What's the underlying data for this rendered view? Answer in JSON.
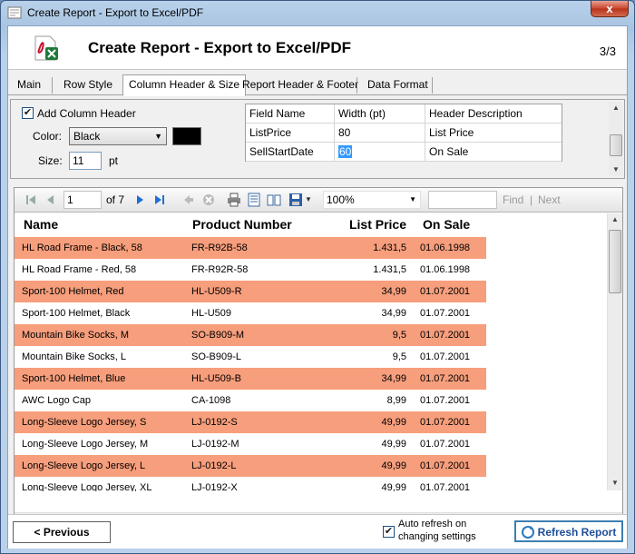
{
  "window": {
    "title": "Create Report - Export to Excel/PDF",
    "close_glyph": "x"
  },
  "header": {
    "title": "Create Report - Export to Excel/PDF",
    "step": "3/3",
    "icon": "excel-pdf-icon"
  },
  "tabs": [
    {
      "label": "Main"
    },
    {
      "label": "Row Style"
    },
    {
      "label": "Column Header & Size",
      "active": true
    },
    {
      "label": "Report Header & Footer"
    },
    {
      "label": "Data Format"
    }
  ],
  "column_header": {
    "add_label": "Add Column Header",
    "add_checked": true,
    "color_label": "Color:",
    "color_value": "Black",
    "color_swatch": "#000000",
    "size_label": "Size:",
    "size_value": "11",
    "size_unit": "pt"
  },
  "fields_grid": {
    "headers": [
      "Field Name",
      "Width (pt)",
      "Header Description"
    ],
    "rows": [
      [
        "ListPrice",
        "80",
        "List Price"
      ],
      [
        "SellStartDate",
        "60",
        "On Sale"
      ]
    ]
  },
  "toolbar": {
    "page_value": "1",
    "page_of": "of 7",
    "zoom": "100%",
    "find": "Find",
    "next": "Next"
  },
  "report": {
    "headers": [
      "Name",
      "Product Number",
      "List Price",
      "On Sale"
    ],
    "row_color": "#f79e7c",
    "rows": [
      [
        "HL Road Frame - Black, 58",
        "FR-R92B-58",
        "1.431,5",
        "01.06.1998"
      ],
      [
        "HL Road Frame - Red, 58",
        "FR-R92R-58",
        "1.431,5",
        "01.06.1998"
      ],
      [
        "Sport-100 Helmet, Red",
        "HL-U509-R",
        "34,99",
        "01.07.2001"
      ],
      [
        "Sport-100 Helmet, Black",
        "HL-U509",
        "34,99",
        "01.07.2001"
      ],
      [
        "Mountain Bike Socks, M",
        "SO-B909-M",
        "9,5",
        "01.07.2001"
      ],
      [
        "Mountain Bike Socks, L",
        "SO-B909-L",
        "9,5",
        "01.07.2001"
      ],
      [
        "Sport-100 Helmet, Blue",
        "HL-U509-B",
        "34,99",
        "01.07.2001"
      ],
      [
        "AWC Logo Cap",
        "CA-1098",
        "8,99",
        "01.07.2001"
      ],
      [
        "Long-Sleeve Logo Jersey, S",
        "LJ-0192-S",
        "49,99",
        "01.07.2001"
      ],
      [
        "Long-Sleeve Logo Jersey, M",
        "LJ-0192-M",
        "49,99",
        "01.07.2001"
      ],
      [
        "Long-Sleeve Logo Jersey, L",
        "LJ-0192-L",
        "49,99",
        "01.07.2001"
      ],
      [
        "Long-Sleeve Logo Jersey, XL",
        "LJ-0192-X",
        "49,99",
        "01.07.2001"
      ]
    ]
  },
  "footer": {
    "previous": "< Previous",
    "auto_refresh_line1": "Auto refresh on",
    "auto_refresh_line2": "changing settings",
    "auto_refresh_checked": true,
    "refresh": "Refresh Report"
  }
}
